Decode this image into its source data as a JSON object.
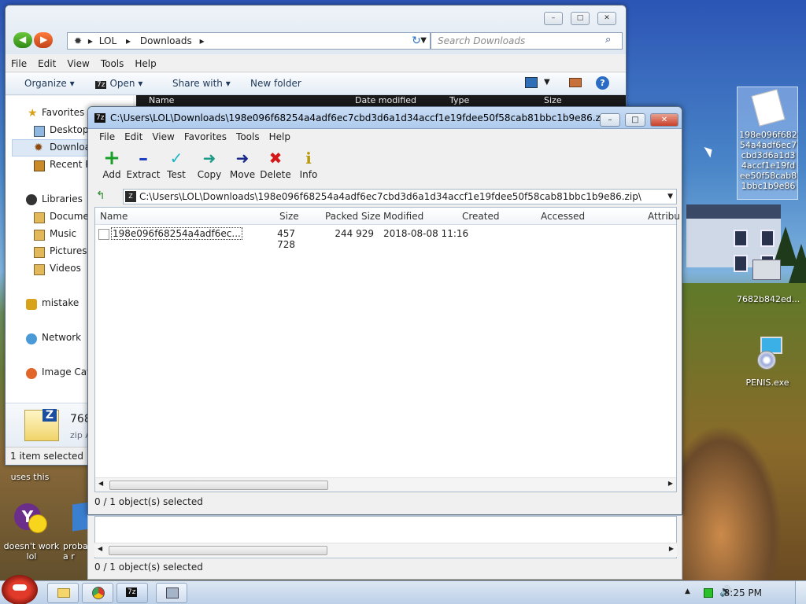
{
  "explorer": {
    "breadcrumb": [
      "LOL",
      "Downloads"
    ],
    "search_placeholder": "Search Downloads",
    "menu": [
      "File",
      "Edit",
      "View",
      "Tools",
      "Help"
    ],
    "commands": {
      "organize": "Organize",
      "open": "Open",
      "share": "Share with",
      "new_folder": "New folder"
    },
    "columns": {
      "name": "Name",
      "date": "Date modified",
      "type": "Type",
      "size": "Size"
    },
    "nav": {
      "favorites": "Favorites",
      "desktop": "Desktop",
      "downloads": "Downloa",
      "recent": "Recent P",
      "libraries": "Libraries",
      "documents": "Documen",
      "music": "Music",
      "pictures": "Pictures",
      "videos": "Videos",
      "mistake": "mistake",
      "network": "Network",
      "image_catalog": "Image Cata"
    },
    "details": {
      "name": "768",
      "type": "zip A"
    },
    "status": "1 item selected"
  },
  "zip": {
    "title": "C:\\Users\\LOL\\Downloads\\198e096f68254a4adf6ec7cbd3d6a1d34accf1e19fdee50f58cab81bbc1b9e86.zip\\",
    "menu": [
      "File",
      "Edit",
      "View",
      "Favorites",
      "Tools",
      "Help"
    ],
    "toolbar": [
      {
        "label": "Add",
        "icon": "add-icon"
      },
      {
        "label": "Extract",
        "icon": "extract-icon"
      },
      {
        "label": "Test",
        "icon": "test-icon"
      },
      {
        "label": "Copy",
        "icon": "copy-icon"
      },
      {
        "label": "Move",
        "icon": "move-icon"
      },
      {
        "label": "Delete",
        "icon": "delete-icon"
      },
      {
        "label": "Info",
        "icon": "info-icon"
      }
    ],
    "path": "C:\\Users\\LOL\\Downloads\\198e096f68254a4adf6ec7cbd3d6a1d34accf1e19fdee50f58cab81bbc1b9e86.zip\\",
    "columns": [
      "Name",
      "Size",
      "Packed Size",
      "Modified",
      "Created",
      "Accessed",
      "Attribu"
    ],
    "rows": [
      {
        "name": "198e096f68254a4adf6ec...",
        "size": "457 728",
        "packed": "244 929",
        "modified": "2018-08-08 11:16"
      }
    ],
    "status": "0 / 1 object(s) selected"
  },
  "ghost_status": "0 / 1 object(s) selected",
  "desktop": {
    "selected_file_label": "198e096f68254a4adf6ec7cbd3d6a1d34accf1e19fdee50f58cab81bbc1b9e86",
    "icon2_label": "7682b842ed...",
    "icon3_label": "PENIS.exe",
    "left_text_1": "uses this",
    "yahoo_label": "doesn't work lol",
    "icon_proba_label": "proba a r"
  },
  "taskbar": {
    "time": "8:25 PM"
  }
}
